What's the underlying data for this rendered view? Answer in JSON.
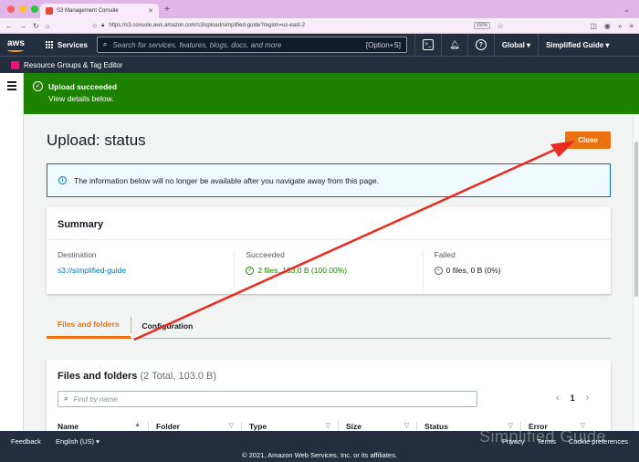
{
  "browser": {
    "tab_title": "S3 Management Console",
    "url": "https://s3.console.aws.amazon.com/s3/upload/simplified-guide?region=us-east-2",
    "zoom": "150%"
  },
  "aws_nav": {
    "logo": "aws",
    "services_label": "Services",
    "search_placeholder": "Search for services, features, blogs, docs, and more",
    "search_shortcut": "[Option+S]",
    "region_label": "Global",
    "account_label": "Simplified Guide"
  },
  "resource_bar": {
    "label": "Resource Groups & Tag Editor"
  },
  "flash": {
    "title": "Upload succeeded",
    "subtitle": "View details below."
  },
  "page": {
    "title": "Upload: status",
    "close_label": "Close",
    "info_text": "The information below will no longer be available after you navigate away from this page."
  },
  "summary": {
    "heading": "Summary",
    "destination_label": "Destination",
    "destination_value": "s3://simplified-guide",
    "succeeded_label": "Succeeded",
    "succeeded_value": "2 files, 103.0 B (100.00%)",
    "failed_label": "Failed",
    "failed_value": "0 files, 0 B (0%)"
  },
  "tabs": {
    "files_and_folders": "Files and folders",
    "configuration": "Configuration"
  },
  "files_panel": {
    "heading": "Files and folders",
    "count": "(2 Total, 103.0 B)",
    "search_placeholder": "Find by name",
    "page_number": "1",
    "columns": [
      "Name",
      "Folder",
      "Type",
      "Size",
      "Status",
      "Error"
    ]
  },
  "footer": {
    "feedback": "Feedback",
    "language": "English (US)",
    "privacy": "Privacy",
    "terms": "Terms",
    "cookie": "Cookie preferences",
    "copyright": "© 2021, Amazon Web Services, Inc. or its affiliates."
  },
  "watermark": "Simplified Guide",
  "colors": {
    "aws_header": "#232f3e",
    "success_green": "#1d8102",
    "primary_orange": "#ec7211",
    "info_blue": "#0073bb",
    "annotation_arrow": "#ea2a1e"
  }
}
